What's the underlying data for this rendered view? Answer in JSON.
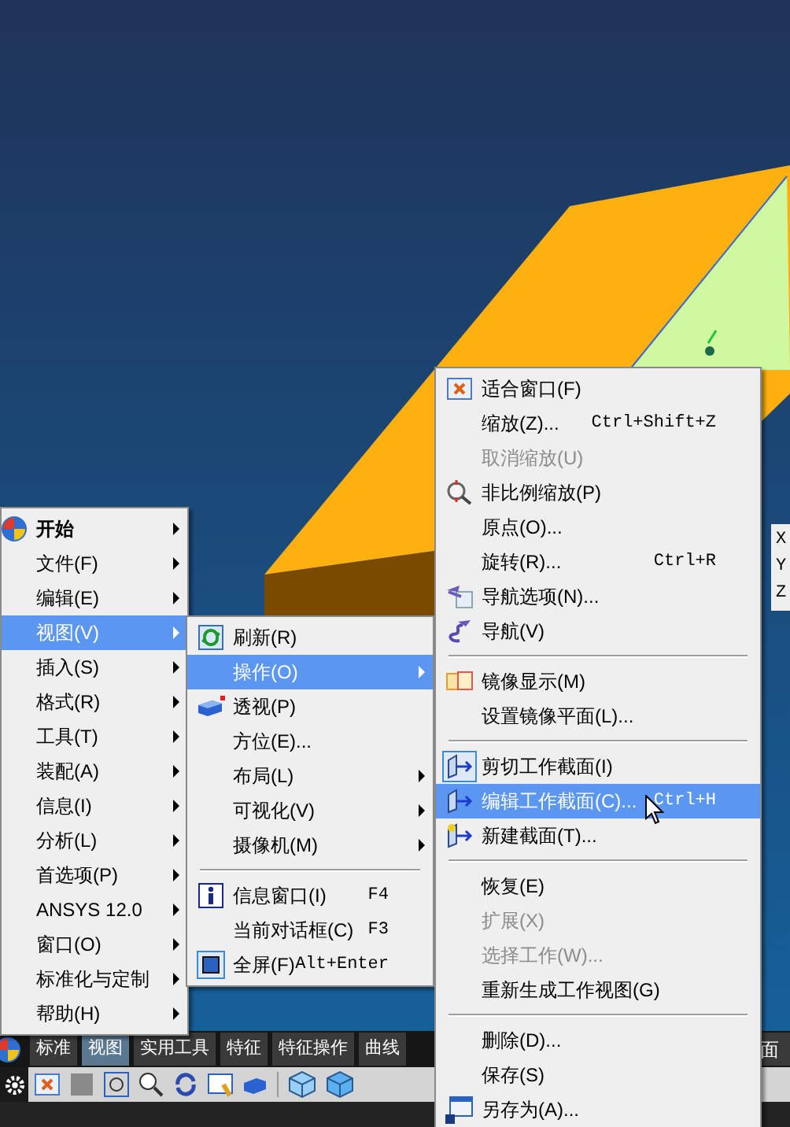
{
  "viewport": {
    "axis_labels": [
      "X",
      "Y",
      "Z"
    ]
  },
  "menus": [
    {
      "items": [
        {
          "kind": "header",
          "label": "开始",
          "submenu": true,
          "selected": false
        },
        {
          "kind": "item",
          "label": "文件(F)",
          "submenu": true,
          "selected": false
        },
        {
          "kind": "item",
          "label": "编辑(E)",
          "submenu": true,
          "selected": false
        },
        {
          "kind": "item",
          "label": "视图(V)",
          "submenu": true,
          "selected": true
        },
        {
          "kind": "item",
          "label": "插入(S)",
          "submenu": true,
          "selected": false
        },
        {
          "kind": "item",
          "label": "格式(R)",
          "submenu": true,
          "selected": false
        },
        {
          "kind": "item",
          "label": "工具(T)",
          "submenu": true,
          "selected": false
        },
        {
          "kind": "item",
          "label": "装配(A)",
          "submenu": true,
          "selected": false
        },
        {
          "kind": "item",
          "label": "信息(I)",
          "submenu": true,
          "selected": false
        },
        {
          "kind": "item",
          "label": "分析(L)",
          "submenu": true,
          "selected": false
        },
        {
          "kind": "item",
          "label": "首选项(P)",
          "submenu": true,
          "selected": false
        },
        {
          "kind": "item",
          "label": "ANSYS 12.0",
          "submenu": true,
          "selected": false
        },
        {
          "kind": "item",
          "label": "窗口(O)",
          "submenu": true,
          "selected": false
        },
        {
          "kind": "item",
          "label": "标准化与定制",
          "submenu": true,
          "selected": false
        },
        {
          "kind": "item",
          "label": "帮助(H)",
          "submenu": true,
          "selected": false
        }
      ]
    },
    {
      "items": [
        {
          "kind": "item",
          "label": "刷新(R)",
          "submenu": false,
          "selected": false
        },
        {
          "kind": "item",
          "label": "操作(O)",
          "submenu": true,
          "selected": true
        },
        {
          "kind": "item",
          "label": "透视(P)",
          "submenu": false,
          "selected": false
        },
        {
          "kind": "item",
          "label": "方位(E)...",
          "submenu": false,
          "selected": false
        },
        {
          "kind": "item",
          "label": "布局(L)",
          "submenu": true,
          "selected": false
        },
        {
          "kind": "item",
          "label": "可视化(V)",
          "submenu": true,
          "selected": false
        },
        {
          "kind": "item",
          "label": "摄像机(M)",
          "submenu": true,
          "selected": false
        },
        {
          "kind": "separator"
        },
        {
          "kind": "item",
          "label": "信息窗口(I)",
          "shortcut": "F4",
          "submenu": false,
          "selected": false
        },
        {
          "kind": "item",
          "label": "当前对话框(C)",
          "shortcut": "F3",
          "submenu": false,
          "selected": false
        },
        {
          "kind": "item",
          "label": "全屏(F)",
          "shortcut": "Alt+Enter",
          "submenu": false,
          "selected": false
        }
      ]
    },
    {
      "items": [
        {
          "kind": "item",
          "label": "适合窗口(F)",
          "selected": false,
          "disabled": false,
          "checked": false
        },
        {
          "kind": "item",
          "label": "缩放(Z)...",
          "shortcut": "Ctrl+Shift+Z",
          "selected": false,
          "disabled": false,
          "checked": false
        },
        {
          "kind": "item",
          "label": "取消缩放(U)",
          "selected": false,
          "disabled": true,
          "checked": false
        },
        {
          "kind": "item",
          "label": "非比例缩放(P)",
          "selected": false,
          "disabled": false,
          "checked": false
        },
        {
          "kind": "item",
          "label": "原点(O)...",
          "selected": false,
          "disabled": false,
          "checked": false
        },
        {
          "kind": "item",
          "label": "旋转(R)...",
          "shortcut": "Ctrl+R",
          "selected": false,
          "disabled": false,
          "checked": false
        },
        {
          "kind": "item",
          "label": "导航选项(N)...",
          "selected": false,
          "disabled": false,
          "checked": false
        },
        {
          "kind": "item",
          "label": "导航(V)",
          "selected": false,
          "disabled": false,
          "checked": false
        },
        {
          "kind": "separator"
        },
        {
          "kind": "item",
          "label": "镜像显示(M)",
          "selected": false,
          "disabled": false,
          "checked": false
        },
        {
          "kind": "item",
          "label": "设置镜像平面(L)...",
          "selected": false,
          "disabled": false,
          "checked": false
        },
        {
          "kind": "separator"
        },
        {
          "kind": "item",
          "label": "剪切工作截面(I)",
          "selected": false,
          "disabled": false,
          "checked": true
        },
        {
          "kind": "item",
          "label": "编辑工作截面(C)...",
          "shortcut": "Ctrl+H",
          "selected": true,
          "disabled": false,
          "checked": false
        },
        {
          "kind": "item",
          "label": "新建截面(T)...",
          "selected": false,
          "disabled": false,
          "checked": false
        },
        {
          "kind": "separator"
        },
        {
          "kind": "item",
          "label": "恢复(E)",
          "selected": false,
          "disabled": false,
          "checked": false
        },
        {
          "kind": "item",
          "label": "扩展(X)",
          "selected": false,
          "disabled": true,
          "checked": false
        },
        {
          "kind": "item",
          "label": "选择工作(W)...",
          "selected": false,
          "disabled": true,
          "checked": false
        },
        {
          "kind": "item",
          "label": "重新生成工作视图(G)",
          "selected": false,
          "disabled": false,
          "checked": false
        },
        {
          "kind": "separator"
        },
        {
          "kind": "item",
          "label": "删除(D)...",
          "selected": false,
          "disabled": false,
          "checked": false
        },
        {
          "kind": "item",
          "label": "保存(S)",
          "selected": false,
          "disabled": false,
          "checked": false
        },
        {
          "kind": "item",
          "label": "另存为(A)...",
          "selected": false,
          "disabled": false,
          "checked": false
        }
      ]
    }
  ],
  "toolbar": {
    "tabs": [
      {
        "label": "标准",
        "selected": false
      },
      {
        "label": "视图",
        "selected": true
      },
      {
        "label": "实用工具",
        "selected": false
      },
      {
        "label": "特征",
        "selected": false
      },
      {
        "label": "特征操作",
        "selected": false
      },
      {
        "label": "曲线",
        "selected": false
      }
    ],
    "right_tab": {
      "label": "面"
    }
  }
}
